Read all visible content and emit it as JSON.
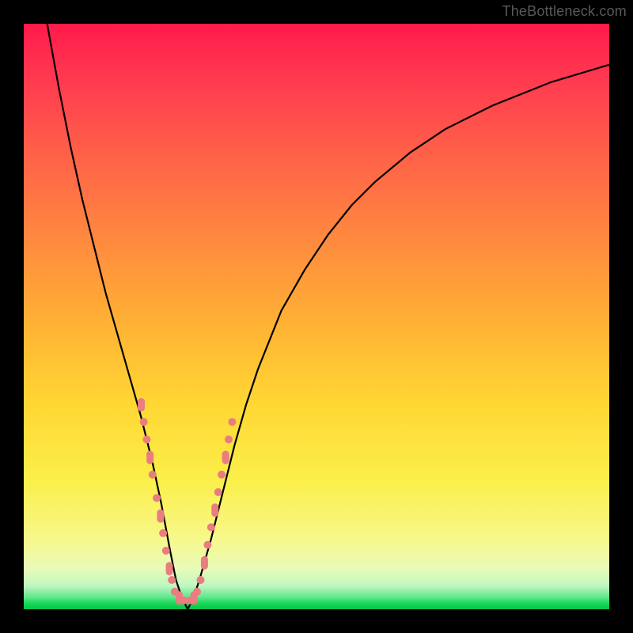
{
  "watermark": "TheBottleneck.com",
  "chart_data": {
    "type": "line",
    "title": "",
    "xlabel": "",
    "ylabel": "",
    "xlim": [
      0,
      100
    ],
    "ylim": [
      0,
      100
    ],
    "series": [
      {
        "name": "curve",
        "x": [
          4,
          6,
          8,
          10,
          12,
          14,
          16,
          18,
          20,
          22,
          23.5,
          25,
          26,
          27,
          28,
          29,
          30,
          32,
          34,
          36,
          38,
          40,
          44,
          48,
          52,
          56,
          60,
          66,
          72,
          80,
          90,
          100
        ],
        "values": [
          100,
          89,
          79,
          70,
          62,
          54,
          47,
          40,
          33,
          25,
          18,
          10,
          5,
          2,
          0,
          2,
          5,
          12,
          20,
          28,
          35,
          41,
          51,
          58,
          64,
          69,
          73,
          78,
          82,
          86,
          90,
          93
        ]
      }
    ],
    "markers": {
      "left_branch": [
        [
          20,
          35
        ],
        [
          20.5,
          32
        ],
        [
          21,
          29
        ],
        [
          21.5,
          26
        ],
        [
          22,
          23
        ],
        [
          22.7,
          19
        ],
        [
          23.3,
          16
        ],
        [
          23.8,
          13
        ],
        [
          24.3,
          10
        ],
        [
          24.8,
          7
        ],
        [
          25.3,
          5
        ],
        [
          25.8,
          3
        ],
        [
          26.5,
          2
        ],
        [
          27.3,
          1.5
        ]
      ],
      "right_branch": [
        [
          28.3,
          1.5
        ],
        [
          29,
          2
        ],
        [
          29.6,
          3
        ],
        [
          30.2,
          5
        ],
        [
          30.8,
          8
        ],
        [
          31.4,
          11
        ],
        [
          32,
          14
        ],
        [
          32.6,
          17
        ],
        [
          33.2,
          20
        ],
        [
          33.8,
          23
        ],
        [
          34.4,
          26
        ],
        [
          35,
          29
        ],
        [
          35.6,
          32
        ]
      ]
    },
    "colors": {
      "curve": "#000000",
      "markers": "#e97d80"
    }
  }
}
